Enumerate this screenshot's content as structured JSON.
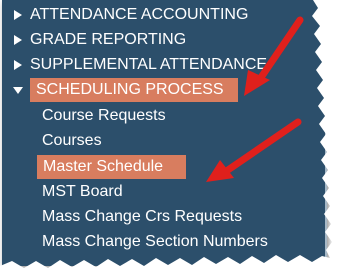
{
  "menu": {
    "categories": [
      {
        "label": "ATTENDANCE ACCOUNTING",
        "expanded": false
      },
      {
        "label": "GRADE REPORTING",
        "expanded": false
      },
      {
        "label": "SUPPLEMENTAL ATTENDANCE",
        "expanded": false
      },
      {
        "label": "SCHEDULING PROCESS",
        "expanded": true
      }
    ],
    "scheduling_items": [
      {
        "label": "Course Requests"
      },
      {
        "label": "Courses"
      },
      {
        "label": "Master Schedule",
        "selected": true
      },
      {
        "label": "MST Board"
      },
      {
        "label": "Mass Change Crs Requests"
      },
      {
        "label": "Mass Change Section Numbers"
      }
    ]
  },
  "colors": {
    "panel_bg": "#2c4f6b",
    "highlight": "#d87d5f",
    "annotation_arrow": "#e0201c",
    "text": "#ffffff"
  },
  "icons": {
    "collapsed": "caret-right-icon",
    "expanded": "caret-down-icon",
    "annotation": "red-arrow-icon"
  }
}
